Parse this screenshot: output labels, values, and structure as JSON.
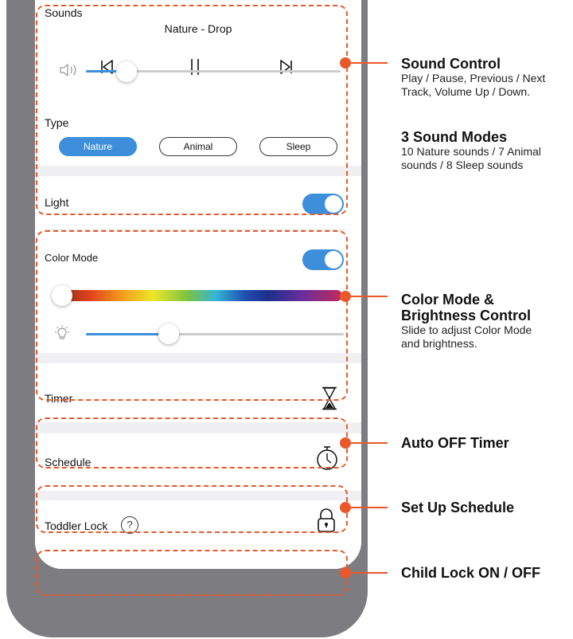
{
  "sounds": {
    "title": "Sounds",
    "track": "Nature - Drop",
    "volume_level": 0.16,
    "type_label": "Type",
    "types": [
      "Nature",
      "Animal",
      "Sleep"
    ],
    "selected_type": "Nature"
  },
  "light": {
    "title": "Light",
    "light_on": true,
    "color_mode_label": "Color Mode",
    "color_mode_on": true,
    "color_level": 0.0,
    "brightness_level": 0.32
  },
  "timer": {
    "label": "Timer"
  },
  "schedule": {
    "label": "Schedule"
  },
  "lock": {
    "label": "Toddler Lock",
    "help": "?"
  },
  "annotations": [
    {
      "title": "Sound Control",
      "text": "Play / Pause, Previous / Next Track, Volume Up / Down."
    },
    {
      "title": "3 Sound Modes",
      "text": "10 Nature sounds / 7 Animal sounds / 8 Sleep sounds"
    },
    {
      "title": "Color Mode & Brightness Control",
      "text": "Slide to adjust Color Mode and brightness."
    },
    {
      "title": "Auto OFF Timer",
      "text": ""
    },
    {
      "title": "Set Up Schedule",
      "text": ""
    },
    {
      "title": "Child Lock ON / OFF",
      "text": ""
    }
  ],
  "colors": {
    "accent": "#3d8fdb",
    "callout": "#e8582a",
    "frame": "#7d7d81"
  }
}
